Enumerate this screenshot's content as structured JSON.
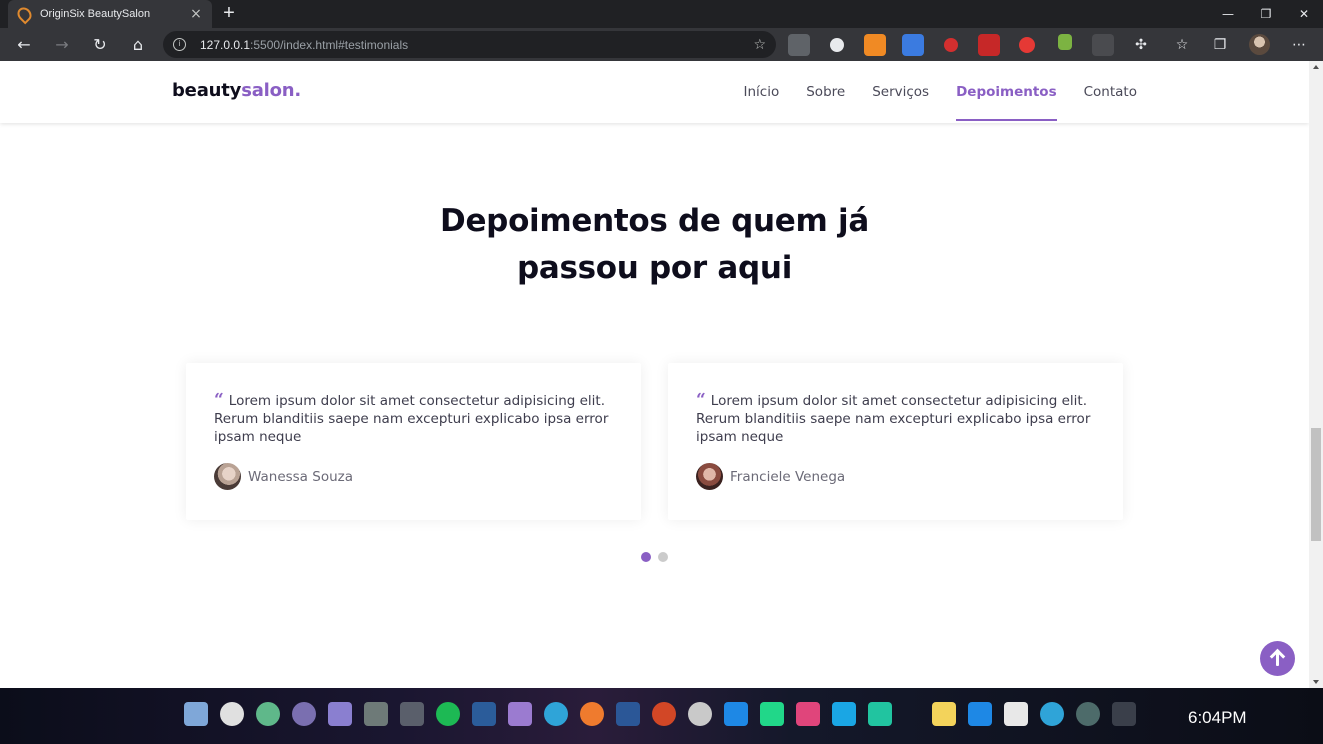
{
  "browser": {
    "tab_title": "OriginSix BeautySalon",
    "tab_close": "×",
    "new_tab": "+",
    "url_host": "127.0.0.1",
    "url_rest": ":5500/index.html#testimonials",
    "window_controls": {
      "minimize": "—",
      "maximize": "❐",
      "close": "✕"
    }
  },
  "site": {
    "logo_main": "beauty",
    "logo_accent": "salon.",
    "nav": [
      {
        "label": "Início",
        "active": false
      },
      {
        "label": "Sobre",
        "active": false
      },
      {
        "label": "Serviços",
        "active": false
      },
      {
        "label": "Depoimentos",
        "active": true
      },
      {
        "label": "Contato",
        "active": false
      }
    ]
  },
  "testimonials": {
    "title_line1": "Depoimentos de quem já",
    "title_line2": "passou por aqui",
    "quote_mark": "“",
    "items": [
      {
        "text": "Lorem ipsum dolor sit amet consectetur adipisicing elit. Rerum blanditiis saepe nam excepturi explicabo ipsa error ipsam neque",
        "author": "Wanessa Souza"
      },
      {
        "text": "Lorem ipsum dolor sit amet consectetur adipisicing elit. Rerum blanditiis saepe nam excepturi explicabo ipsa error ipsam neque",
        "author": "Franciele Venega"
      }
    ],
    "pagination": {
      "pages": 2,
      "active": 1
    }
  },
  "taskbar": {
    "clock": "6:04PM"
  },
  "colors": {
    "accent": "#8a5fc4",
    "heading": "#0e0d1c"
  }
}
